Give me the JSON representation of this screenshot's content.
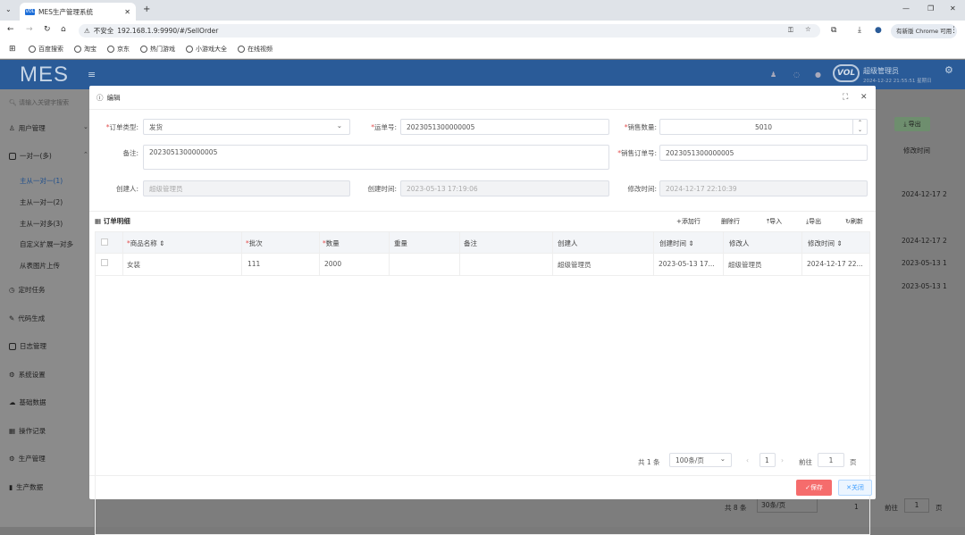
{
  "browser": {
    "tab_title": "MES生产管理系统",
    "tab_fav": "VOL",
    "not_secure": "不安全",
    "url": "192.168.1.9:9990/#/SellOrder",
    "update_badge": "有新版 Chrome 可用",
    "bookmarks": [
      "百度搜索",
      "淘宝",
      "京东",
      "热门游戏",
      "小游戏大全",
      "在线视频"
    ]
  },
  "app": {
    "logo": "MES",
    "user_name": "超级管理员",
    "user_time": "2024-12-22 21:55:51 星期日",
    "search_placeholder": "请输入关键字搜索"
  },
  "sidebar": {
    "items": [
      {
        "label": "用户管理"
      },
      {
        "label": "一对一(多)"
      },
      {
        "label": "定时任务"
      },
      {
        "label": "代码生成"
      },
      {
        "label": "日志管理"
      },
      {
        "label": "系统设置"
      },
      {
        "label": "基础数据"
      },
      {
        "label": "操作记录"
      },
      {
        "label": "生产管理"
      },
      {
        "label": "生产数据"
      }
    ],
    "subitems": [
      "主从一对一(1)",
      "主从一对一(2)",
      "主从一对多(3)",
      "自定义扩展一对多",
      "从表图片上传"
    ]
  },
  "background": {
    "btn_export": "导出",
    "col_modified": "修改时间",
    "rows": [
      "2024-12-17 2",
      "2024-12-17 2",
      "2023-05-13 1",
      "2023-05-13 1"
    ],
    "total": "共 8 条",
    "page_size": "30条/页",
    "goto": "前往",
    "page": "1",
    "page_unit": "页"
  },
  "dialog": {
    "title": "编辑",
    "form": {
      "order_type_label": "订单类型:",
      "order_type_value": "发货",
      "ship_no_label": "运单号:",
      "ship_no_value": "2023051300000005",
      "qty_label": "销售数量:",
      "qty_value": "5010",
      "remark_label": "备注:",
      "remark_value": "2023051300000005",
      "sell_no_label": "销售订单号:",
      "sell_no_value": "2023051300000005",
      "creator_label": "创建人:",
      "creator_value": "超级管理员",
      "created_label": "创建时间:",
      "created_value": "2023-05-13 17:19:06",
      "modified_label": "修改时间:",
      "modified_value": "2024-12-17 22:10:39"
    },
    "detail": {
      "title": "订单明细",
      "toolbar": [
        "+添加行",
        "删除行",
        "导入",
        "导出",
        "刷新"
      ],
      "columns": [
        "商品名称",
        "批次",
        "数量",
        "重量",
        "备注",
        "创建人",
        "创建时间",
        "修改人",
        "修改时间"
      ],
      "rows": [
        {
          "name": "女装",
          "batch": "111",
          "qty": "2000",
          "weight": "",
          "remark": "",
          "creator": "超级管理员",
          "created": "2023-05-13 17...",
          "modifier": "超级管理员",
          "modified": "2024-12-17 22..."
        }
      ]
    },
    "pagination": {
      "total": "共 1 条",
      "page_size": "100条/页",
      "page": "1",
      "goto": "前往",
      "goto_value": "1",
      "unit": "页"
    },
    "save": "保存",
    "close": "关闭"
  }
}
